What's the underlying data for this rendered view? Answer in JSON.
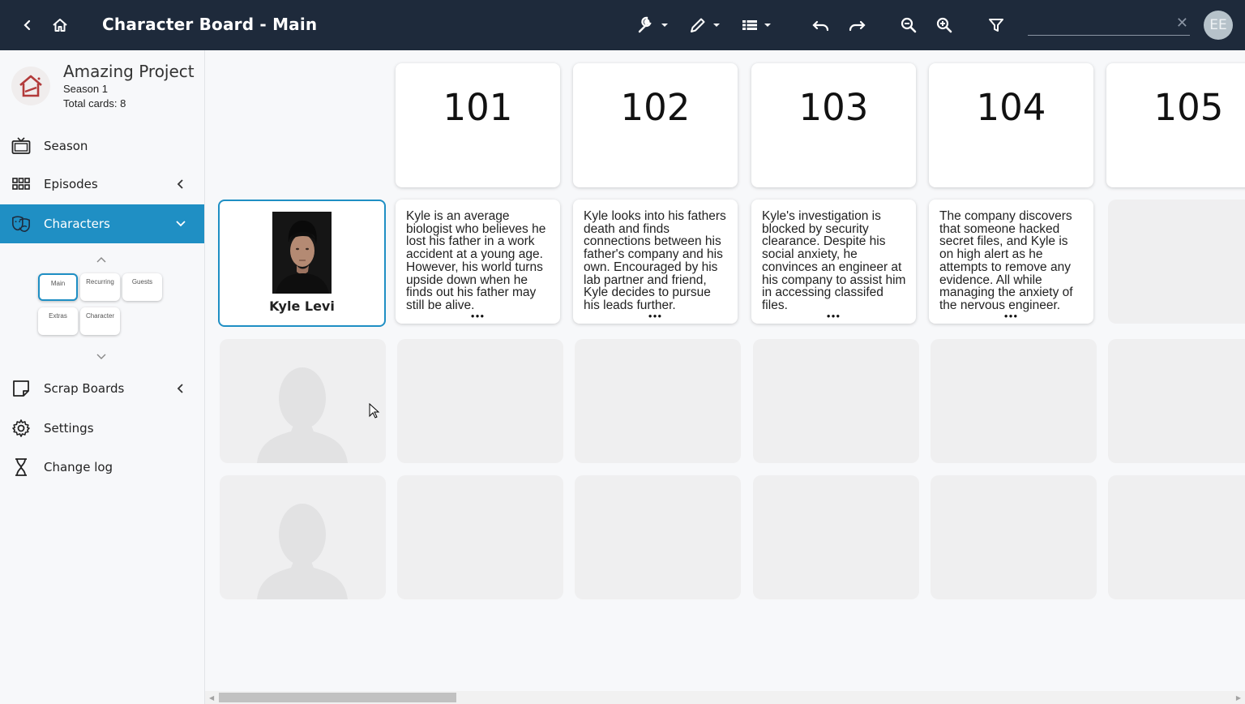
{
  "topbar": {
    "title": "Character Board - Main",
    "search": {
      "value": "",
      "placeholder": ""
    },
    "clear_glyph": "✕",
    "avatar_initials": "EE",
    "icons": [
      "back-arrow-icon",
      "home-icon",
      "wrench-icon",
      "pencil-icon",
      "list-view-icon",
      "undo-icon",
      "redo-icon",
      "zoom-out-icon",
      "zoom-in-icon",
      "filter-icon"
    ]
  },
  "project": {
    "name": "Amazing Project",
    "season": "Season 1",
    "total_cards": "Total cards: 8"
  },
  "nav": {
    "season": "Season",
    "episodes": "Episodes",
    "characters": "Characters",
    "scrap_boards": "Scrap Boards",
    "settings": "Settings",
    "change_log": "Change log"
  },
  "character_boards": {
    "main": "Main",
    "recurring": "Recurring",
    "guests": "Guests",
    "extras": "Extras",
    "character": "Character"
  },
  "episodes": [
    "101",
    "102",
    "103",
    "104",
    "105"
  ],
  "character": {
    "name": "Kyle Levi",
    "stories": [
      "Kyle is an average biologist who believes he lost his father in a work accident at a young age. However, his world turns upside down when he finds out his father may still be alive.",
      "Kyle looks into his fathers death and finds connections between his father's company and his own. Encouraged by his lab partner and friend, Kyle decides to pursue his leads further.",
      "Kyle's investigation is blocked by security clearance. Despite his social anxiety, he convinces an engineer at his company to assist him in accessing classifed files.",
      "The company discovers that someone hacked secret files, and Kyle is on high alert as he attempts to remove any evidence. All while managing the anxiety of the nervous engineer."
    ],
    "more_glyph": "●●●"
  },
  "colors": {
    "topbar": "#1e2a3b",
    "accent": "#1f8fc4",
    "empty_card": "#efeff0"
  }
}
